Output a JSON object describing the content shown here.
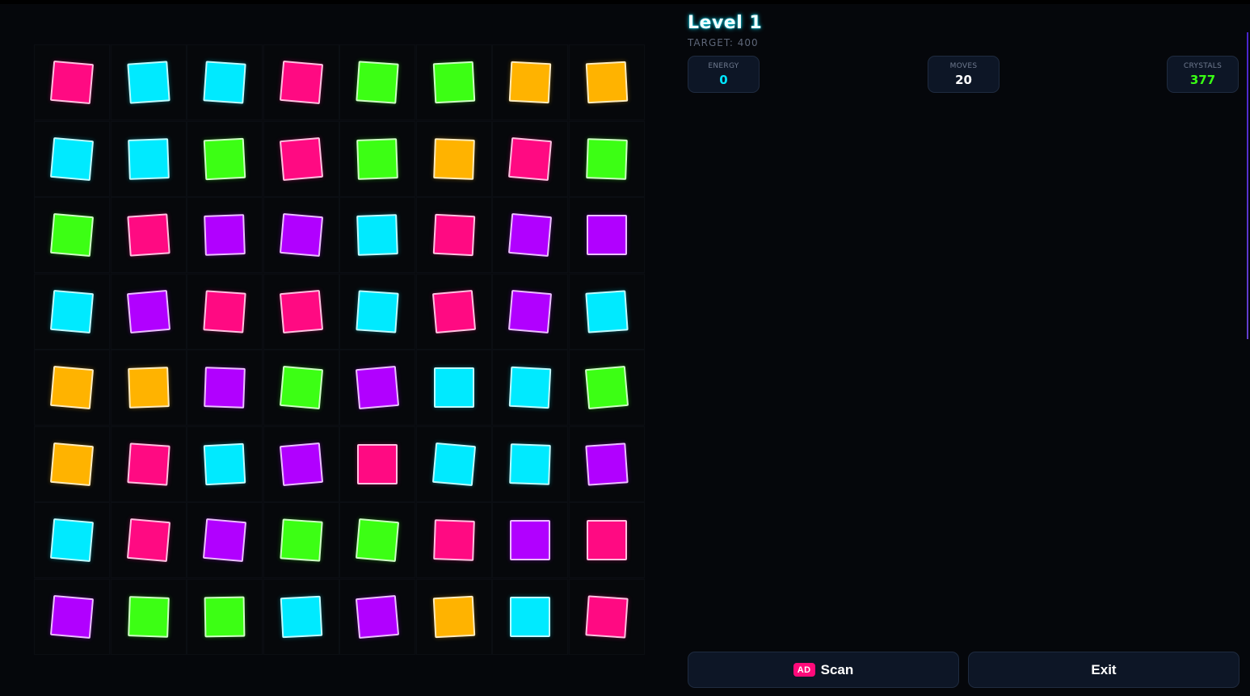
{
  "hud": {
    "level_title": "Level 1",
    "target_text": "TARGET: 400",
    "stats": [
      {
        "label": "ENERGY",
        "value": "0",
        "color": "#00e5ff"
      },
      {
        "label": "MOVES",
        "value": "20",
        "color": "#ffffff"
      },
      {
        "label": "CRYSTALS",
        "value": "377",
        "color": "#39ff14"
      }
    ]
  },
  "buttons": {
    "scan_badge": "AD",
    "scan_label": "Scan",
    "exit_label": "Exit"
  },
  "colors": {
    "pink": "#ff0a82",
    "cyan": "#00eaff",
    "green": "#3cff14",
    "orange": "#ffb300",
    "purple": "#b100ff"
  },
  "board": {
    "rows": [
      [
        "pink",
        "cyan",
        "cyan",
        "pink",
        "green",
        "green",
        "orange",
        "orange"
      ],
      [
        "cyan",
        "cyan",
        "green",
        "pink",
        "green",
        "orange",
        "pink",
        "green"
      ],
      [
        "green",
        "pink",
        "purple",
        "purple",
        "cyan",
        "pink",
        "purple",
        "purple"
      ],
      [
        "cyan",
        "purple",
        "pink",
        "pink",
        "cyan",
        "pink",
        "purple",
        "cyan"
      ],
      [
        "orange",
        "orange",
        "purple",
        "green",
        "purple",
        "cyan",
        "cyan",
        "green"
      ],
      [
        "orange",
        "pink",
        "cyan",
        "purple",
        "pink",
        "cyan",
        "cyan",
        "purple"
      ],
      [
        "cyan",
        "pink",
        "purple",
        "green",
        "green",
        "pink",
        "purple",
        "pink"
      ],
      [
        "purple",
        "green",
        "green",
        "cyan",
        "purple",
        "orange",
        "cyan",
        "pink"
      ]
    ]
  }
}
